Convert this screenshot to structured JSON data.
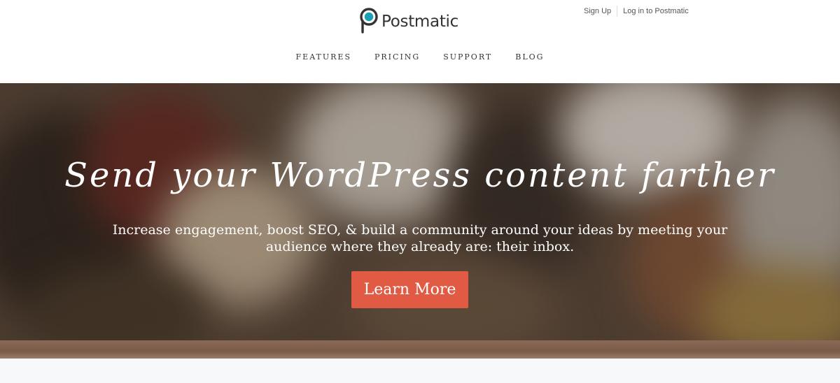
{
  "brand": {
    "name": "Postmatic",
    "icon": "postmatic-p-logo",
    "colors": {
      "logo_teal": "#1aa0b3",
      "logo_dark": "#333333"
    }
  },
  "top_links": {
    "signup": "Sign Up",
    "login": "Log in to Postmatic"
  },
  "nav": {
    "items": [
      "FEATURES",
      "PRICING",
      "SUPPORT",
      "BLOG"
    ]
  },
  "hero": {
    "title": "Send your WordPress content farther",
    "subtitle": "Increase engagement, boost SEO, & build a community around your ideas by meeting your audience where they already are: their inbox.",
    "cta_label": "Learn More",
    "cta_color": "#e15a43"
  }
}
